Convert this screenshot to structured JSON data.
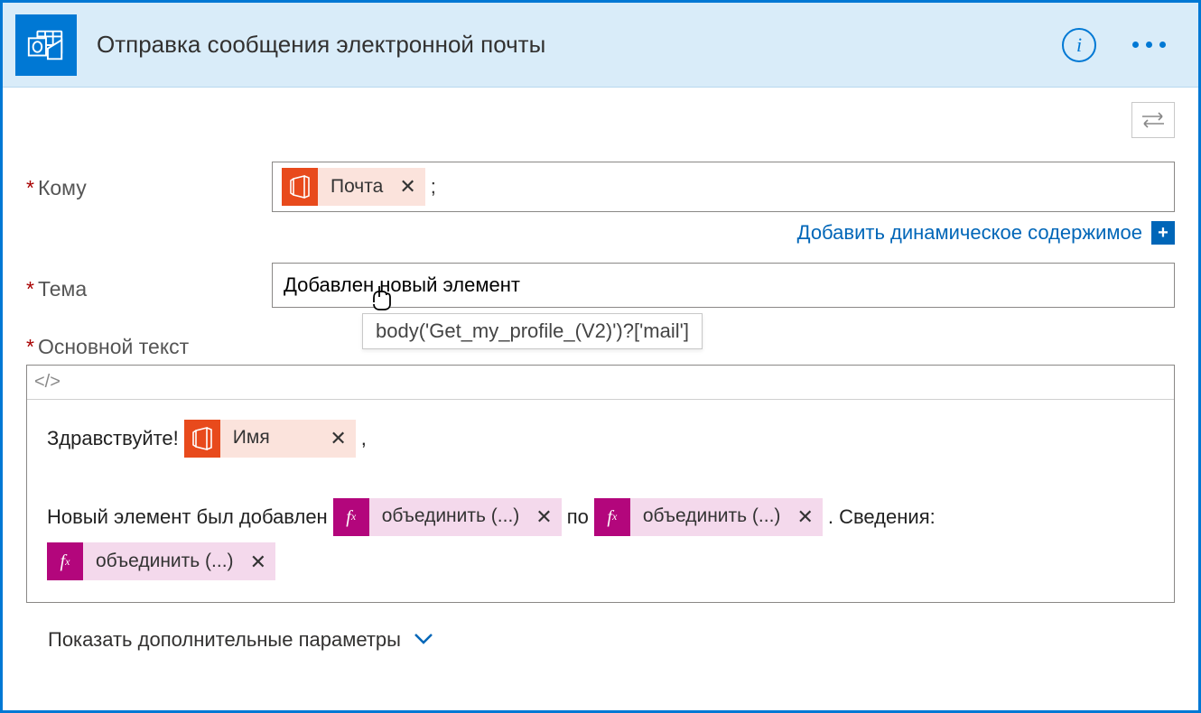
{
  "header": {
    "title": "Отправка сообщения электронной почты"
  },
  "fields": {
    "to": {
      "label": "Кому",
      "token_label": "Почта",
      "after": ";"
    },
    "subject": {
      "label": "Тема",
      "value": "Добавлен новый элемент"
    },
    "body": {
      "label": "Основной текст"
    }
  },
  "tooltip": "body('Get_my_profile_(V2)')?['mail']",
  "dynContent": "Добавить динамическое содержимое",
  "editor": {
    "greeting": "Здравствуйте!",
    "name_token": "Имя",
    "comma": ",",
    "line2_prefix": "Новый элемент был добавлен",
    "combine": "объединить (...)",
    "po": "по",
    "details": ". Сведения:"
  },
  "advanced": "Показать дополнительные параметры",
  "code_toggle": "</>"
}
